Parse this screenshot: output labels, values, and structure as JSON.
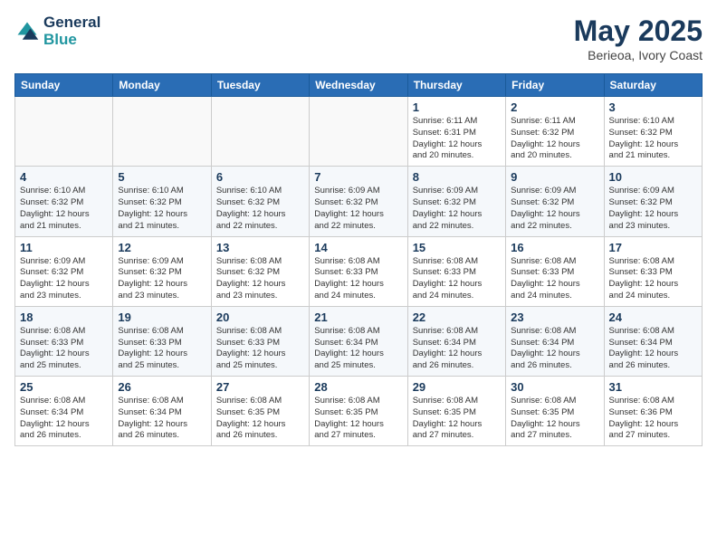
{
  "header": {
    "logo_line1": "General",
    "logo_line2": "Blue",
    "month": "May 2025",
    "location": "Berieoa, Ivory Coast"
  },
  "weekdays": [
    "Sunday",
    "Monday",
    "Tuesday",
    "Wednesday",
    "Thursday",
    "Friday",
    "Saturday"
  ],
  "weeks": [
    [
      {
        "day": "",
        "info": ""
      },
      {
        "day": "",
        "info": ""
      },
      {
        "day": "",
        "info": ""
      },
      {
        "day": "",
        "info": ""
      },
      {
        "day": "1",
        "info": "Sunrise: 6:11 AM\nSunset: 6:31 PM\nDaylight: 12 hours\nand 20 minutes."
      },
      {
        "day": "2",
        "info": "Sunrise: 6:11 AM\nSunset: 6:32 PM\nDaylight: 12 hours\nand 20 minutes."
      },
      {
        "day": "3",
        "info": "Sunrise: 6:10 AM\nSunset: 6:32 PM\nDaylight: 12 hours\nand 21 minutes."
      }
    ],
    [
      {
        "day": "4",
        "info": "Sunrise: 6:10 AM\nSunset: 6:32 PM\nDaylight: 12 hours\nand 21 minutes."
      },
      {
        "day": "5",
        "info": "Sunrise: 6:10 AM\nSunset: 6:32 PM\nDaylight: 12 hours\nand 21 minutes."
      },
      {
        "day": "6",
        "info": "Sunrise: 6:10 AM\nSunset: 6:32 PM\nDaylight: 12 hours\nand 22 minutes."
      },
      {
        "day": "7",
        "info": "Sunrise: 6:09 AM\nSunset: 6:32 PM\nDaylight: 12 hours\nand 22 minutes."
      },
      {
        "day": "8",
        "info": "Sunrise: 6:09 AM\nSunset: 6:32 PM\nDaylight: 12 hours\nand 22 minutes."
      },
      {
        "day": "9",
        "info": "Sunrise: 6:09 AM\nSunset: 6:32 PM\nDaylight: 12 hours\nand 22 minutes."
      },
      {
        "day": "10",
        "info": "Sunrise: 6:09 AM\nSunset: 6:32 PM\nDaylight: 12 hours\nand 23 minutes."
      }
    ],
    [
      {
        "day": "11",
        "info": "Sunrise: 6:09 AM\nSunset: 6:32 PM\nDaylight: 12 hours\nand 23 minutes."
      },
      {
        "day": "12",
        "info": "Sunrise: 6:09 AM\nSunset: 6:32 PM\nDaylight: 12 hours\nand 23 minutes."
      },
      {
        "day": "13",
        "info": "Sunrise: 6:08 AM\nSunset: 6:32 PM\nDaylight: 12 hours\nand 23 minutes."
      },
      {
        "day": "14",
        "info": "Sunrise: 6:08 AM\nSunset: 6:33 PM\nDaylight: 12 hours\nand 24 minutes."
      },
      {
        "day": "15",
        "info": "Sunrise: 6:08 AM\nSunset: 6:33 PM\nDaylight: 12 hours\nand 24 minutes."
      },
      {
        "day": "16",
        "info": "Sunrise: 6:08 AM\nSunset: 6:33 PM\nDaylight: 12 hours\nand 24 minutes."
      },
      {
        "day": "17",
        "info": "Sunrise: 6:08 AM\nSunset: 6:33 PM\nDaylight: 12 hours\nand 24 minutes."
      }
    ],
    [
      {
        "day": "18",
        "info": "Sunrise: 6:08 AM\nSunset: 6:33 PM\nDaylight: 12 hours\nand 25 minutes."
      },
      {
        "day": "19",
        "info": "Sunrise: 6:08 AM\nSunset: 6:33 PM\nDaylight: 12 hours\nand 25 minutes."
      },
      {
        "day": "20",
        "info": "Sunrise: 6:08 AM\nSunset: 6:33 PM\nDaylight: 12 hours\nand 25 minutes."
      },
      {
        "day": "21",
        "info": "Sunrise: 6:08 AM\nSunset: 6:34 PM\nDaylight: 12 hours\nand 25 minutes."
      },
      {
        "day": "22",
        "info": "Sunrise: 6:08 AM\nSunset: 6:34 PM\nDaylight: 12 hours\nand 26 minutes."
      },
      {
        "day": "23",
        "info": "Sunrise: 6:08 AM\nSunset: 6:34 PM\nDaylight: 12 hours\nand 26 minutes."
      },
      {
        "day": "24",
        "info": "Sunrise: 6:08 AM\nSunset: 6:34 PM\nDaylight: 12 hours\nand 26 minutes."
      }
    ],
    [
      {
        "day": "25",
        "info": "Sunrise: 6:08 AM\nSunset: 6:34 PM\nDaylight: 12 hours\nand 26 minutes."
      },
      {
        "day": "26",
        "info": "Sunrise: 6:08 AM\nSunset: 6:34 PM\nDaylight: 12 hours\nand 26 minutes."
      },
      {
        "day": "27",
        "info": "Sunrise: 6:08 AM\nSunset: 6:35 PM\nDaylight: 12 hours\nand 26 minutes."
      },
      {
        "day": "28",
        "info": "Sunrise: 6:08 AM\nSunset: 6:35 PM\nDaylight: 12 hours\nand 27 minutes."
      },
      {
        "day": "29",
        "info": "Sunrise: 6:08 AM\nSunset: 6:35 PM\nDaylight: 12 hours\nand 27 minutes."
      },
      {
        "day": "30",
        "info": "Sunrise: 6:08 AM\nSunset: 6:35 PM\nDaylight: 12 hours\nand 27 minutes."
      },
      {
        "day": "31",
        "info": "Sunrise: 6:08 AM\nSunset: 6:36 PM\nDaylight: 12 hours\nand 27 minutes."
      }
    ]
  ]
}
